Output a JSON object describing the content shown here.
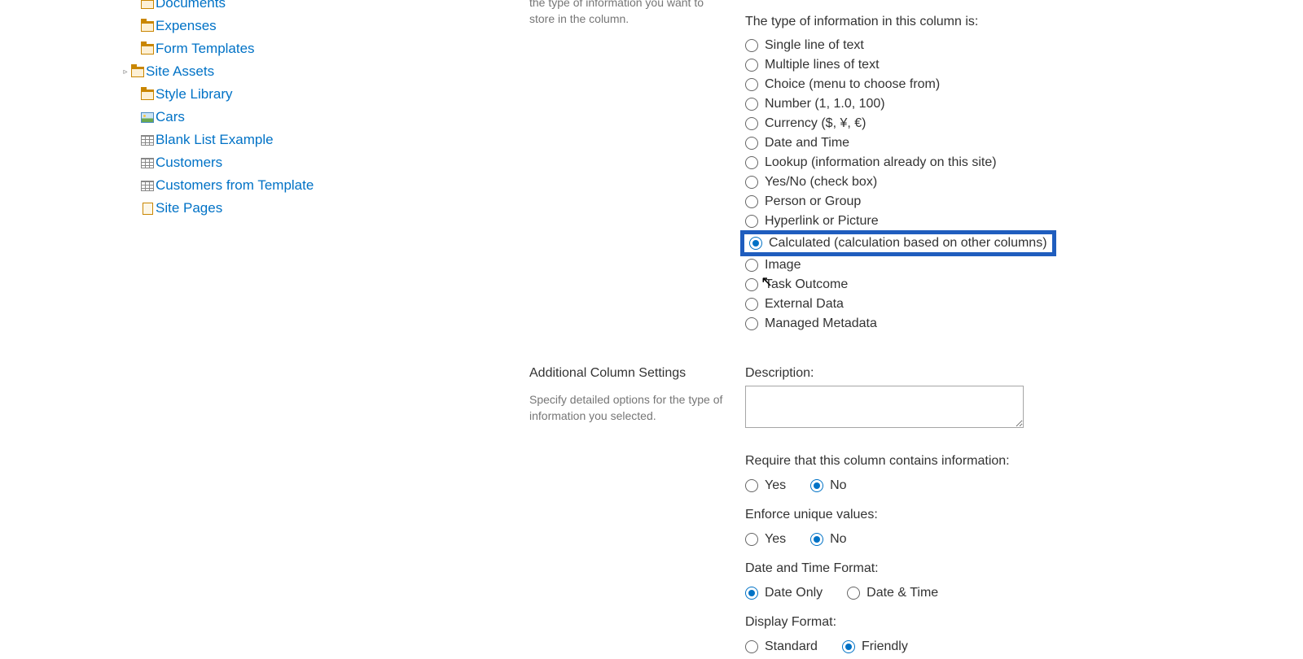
{
  "sidebar": {
    "items": [
      {
        "label": "Documents",
        "icon": "folder",
        "truncated": true,
        "indent": 1
      },
      {
        "label": "Expenses",
        "icon": "folder",
        "indent": 1
      },
      {
        "label": "Form Templates",
        "icon": "folder",
        "indent": 1
      },
      {
        "label": "Site Assets",
        "icon": "folder",
        "expandable": true,
        "indent": 1
      },
      {
        "label": "Style Library",
        "icon": "folder",
        "indent": 1
      },
      {
        "label": "Cars",
        "icon": "image",
        "indent": 1
      },
      {
        "label": "Blank List Example",
        "icon": "list",
        "indent": 1
      },
      {
        "label": "Customers",
        "icon": "list",
        "indent": 1
      },
      {
        "label": "Customers from Template",
        "icon": "list",
        "indent": 1
      },
      {
        "label": "Site Pages",
        "icon": "page",
        "indent": 1
      }
    ]
  },
  "section_type": {
    "desc": "the type of information you want to store in the column.",
    "header": "The type of information in this column is:",
    "options": [
      "Single line of text",
      "Multiple lines of text",
      "Choice (menu to choose from)",
      "Number (1, 1.0, 100)",
      "Currency ($, ¥, €)",
      "Date and Time",
      "Lookup (information already on this site)",
      "Yes/No (check box)",
      "Person or Group",
      "Hyperlink or Picture",
      "Calculated (calculation based on other columns)",
      "Image",
      "Task Outcome",
      "External Data",
      "Managed Metadata"
    ],
    "selected_index": 10
  },
  "section_additional": {
    "heading": "Additional Column Settings",
    "desc": "Specify detailed options for the type of information you selected.",
    "description_label": "Description:",
    "description_value": "",
    "require_label": "Require that this column contains information:",
    "enforce_label": "Enforce unique values:",
    "yes": "Yes",
    "no": "No",
    "require_selected": "No",
    "enforce_selected": "No",
    "datetime_label": "Date and Time Format:",
    "date_only": "Date Only",
    "date_and_time": "Date & Time",
    "datetime_selected": "Date Only",
    "display_label": "Display Format:",
    "standard": "Standard",
    "friendly": "Friendly",
    "display_selected": "Friendly"
  }
}
